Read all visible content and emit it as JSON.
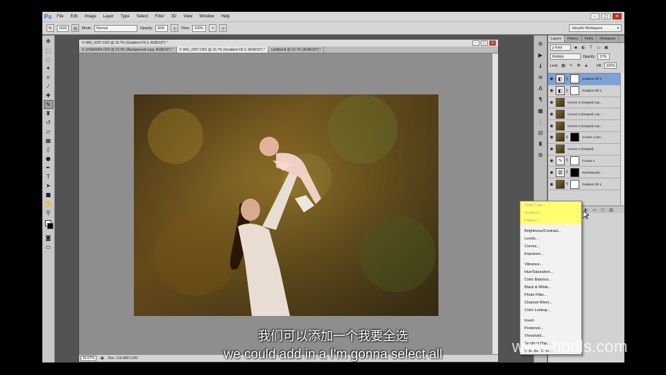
{
  "menubar": {
    "logo": "Ps",
    "items": [
      "File",
      "Edit",
      "Image",
      "Layer",
      "Type",
      "Select",
      "Filter",
      "3D",
      "View",
      "Window",
      "Help"
    ],
    "controls": [
      "–",
      "□",
      "×"
    ]
  },
  "options": {
    "brush_size": "2026",
    "mode_label": "Mode:",
    "mode_value": "Normal",
    "opacity_label": "Opacity:",
    "opacity_value": "66%",
    "flow_label": "Flow:",
    "flow_value": "100%",
    "workspace": "JoleyArt Workspace"
  },
  "tools": [
    "move-icon",
    "marquee-icon",
    "lasso-icon",
    "quick-select-icon",
    "crop-icon",
    "eyedropper-icon",
    "healing-icon",
    "brush-icon",
    "stamp-icon",
    "history-brush-icon",
    "eraser-icon",
    "gradient-icon",
    "blur-icon",
    "dodge-icon",
    "pen-icon",
    "type-icon",
    "path-select-icon",
    "shape-icon",
    "hand-icon",
    "zoom-icon"
  ],
  "document": {
    "title": "© IMG_0207.CR2 @ 16.7% (Gradient Fill 3, RGB/16*) *",
    "tabs": [
      "© 1HSA6094.CR2 @ 22.6% (Background copy, RGB/16*) *",
      "© IMG_0207.CR2 @ 16.7% (Gradient Fill 3, RGB/16*) *",
      "Untitled-8 @ 16.7% (RGB/16*) *"
    ],
    "zoom": "16.67%",
    "doc_info": "Doc: 116.0M/1.53G"
  },
  "layers_panel": {
    "tabs": [
      "Layers",
      "History",
      "Paths",
      "Histogram"
    ],
    "kind": "ρ Kind",
    "blend_mode": "Multiply",
    "opacity_label": "Opacity:",
    "opacity_value": "37%",
    "lock_label": "Lock:",
    "fill_label": "Fill:",
    "fill_value": "100%",
    "layers": [
      {
        "name": "Gradient Fill 3"
      },
      {
        "name": "Gradient Fill 2"
      },
      {
        "name": "Curves 4 (merged) cop..."
      },
      {
        "name": "Curves 4 (merged) cop..."
      },
      {
        "name": "Curves 4 (merged) cop..."
      },
      {
        "name": "Curves 4 (me..."
      },
      {
        "name": "Curves 4 (merged)"
      },
      {
        "name": "Curves 4"
      },
      {
        "name": "Hue/Saturati..."
      },
      {
        "name": "Gradient Fill 1"
      }
    ]
  },
  "adjust_menu": {
    "group1": [
      "Solid Color...",
      "Gradient...",
      "Pattern..."
    ],
    "group2": [
      "Brightness/Contrast...",
      "Levels...",
      "Curves...",
      "Exposure..."
    ],
    "group3": [
      "Vibrance...",
      "Hue/Saturation...",
      "Color Balance...",
      "Black & White...",
      "Photo Filter...",
      "Channel Mixer...",
      "Color Lookup..."
    ],
    "group4": [
      "Invert",
      "Posterize...",
      "Threshold...",
      "Gradient Map...",
      "Selective Color..."
    ]
  },
  "subtitles": {
    "chinese": "我们可以添加一个我要全选",
    "english": "we could add in a I'm gonna select all"
  },
  "watermark": "www.hbdls.com"
}
